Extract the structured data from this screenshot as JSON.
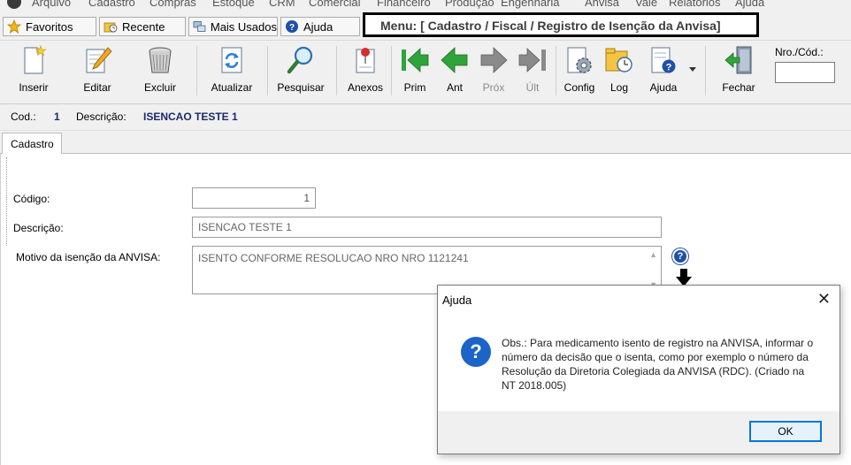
{
  "menu": {
    "items": [
      "Arquivo",
      "Cadastro",
      "Compras",
      "Estoque",
      "CRM",
      "Comercial",
      "Financeiro",
      "Produção",
      "Engenharia",
      "Anvisa",
      "Vale",
      "Relatórios",
      "Ajuda"
    ]
  },
  "quickbar": {
    "favoritos": "Favoritos",
    "recente": "Recente",
    "mais_usados": "Mais Usados",
    "ajuda": "Ajuda",
    "menu_path": "Menu: [ Cadastro / Fiscal / Registro de Isenção da Anvisa]"
  },
  "toolbar": {
    "inserir": "Inserir",
    "editar": "Editar",
    "excluir": "Excluir",
    "atualizar": "Atualizar",
    "pesquisar": "Pesquisar",
    "anexos": "Anexos",
    "prim": "Prim",
    "ant": "Ant",
    "prox": "Próx",
    "ult": "Últ",
    "config": "Config",
    "log": "Log",
    "ajuda": "Ajuda",
    "fechar": "Fechar",
    "nro_cod_label": "Nro./Cód.:",
    "nro_cod_value": ""
  },
  "record": {
    "cod_label": "Cod.:",
    "cod_value": "1",
    "descricao_label": "Descrição:",
    "descricao_value": "ISENCAO TESTE 1"
  },
  "tabs": [
    "Cadastro"
  ],
  "form": {
    "codigo_label": "Código:",
    "codigo_value": "1",
    "descricao_label": "Descrição:",
    "descricao_value": "ISENCAO TESTE 1",
    "motivo_label": "Motivo da isenção da ANVISA:",
    "motivo_value": "ISENTO CONFORME RESOLUCAO NRO NRO 1121241"
  },
  "dialog": {
    "title": "Ajuda",
    "close": "✕",
    "icon": "?",
    "message": "Obs.: Para medicamento isento de registro na ANVISA, informar o número da decisão que o isenta, como por exemplo o número da Resolução da Diretoria Colegiada da ANVISA (RDC). (Criado na NT 2018.005)",
    "ok": "OK"
  },
  "colors": {
    "accent": "#0078d7",
    "record_value": "#1a2a6c",
    "help_icon": "#1b64c8",
    "nav_green": "#2fa43a"
  }
}
